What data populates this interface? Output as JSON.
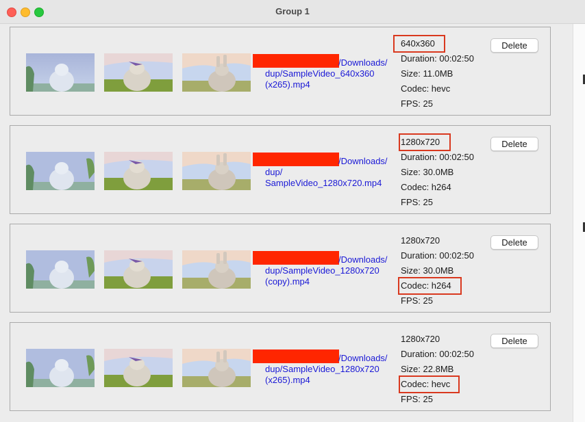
{
  "window": {
    "title": "Group 1"
  },
  "items": [
    {
      "path_line1": "/Downloads/",
      "path_rest": "dup/SampleVideo_640x360\n(x265).mp4",
      "resolution": "640x360",
      "duration": "Duration: 00:02:50",
      "size": "Size: 11.0MB",
      "codec": "Codec: hevc",
      "fps": "FPS: 25",
      "delete_label": "Delete"
    },
    {
      "path_line1": "/Downloads/",
      "path_rest": "dup/\nSampleVideo_1280x720.mp4",
      "resolution": "1280x720",
      "duration": "Duration: 00:02:50",
      "size": "Size: 30.0MB",
      "codec": "Codec: h264",
      "fps": "FPS: 25",
      "delete_label": "Delete"
    },
    {
      "path_line1": "/Downloads/",
      "path_rest": "dup/SampleVideo_1280x720\n(copy).mp4",
      "resolution": "1280x720",
      "duration": "Duration: 00:02:50",
      "size": "Size: 30.0MB",
      "codec": "Codec: h264",
      "fps": "FPS: 25",
      "delete_label": "Delete"
    },
    {
      "path_line1": "/Downloads/",
      "path_rest": "dup/SampleVideo_1280x720\n(x265).mp4",
      "resolution": "1280x720",
      "duration": "Duration: 00:02:50",
      "size": "Size: 22.8MB",
      "codec": "Codec: hevc",
      "fps": "FPS: 25",
      "delete_label": "Delete"
    }
  ],
  "colors": {
    "redaction": "#ff2600",
    "highlight": "#d9381e",
    "link": "#1a18d6"
  }
}
